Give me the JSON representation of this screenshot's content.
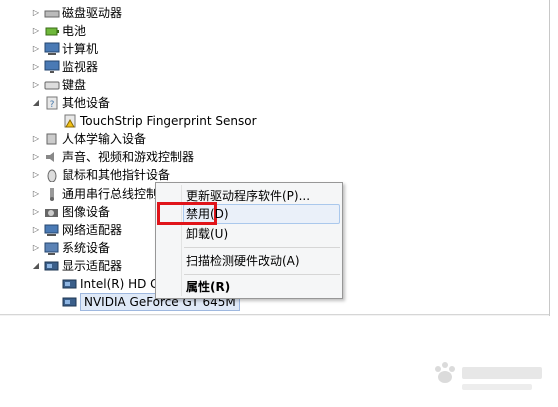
{
  "tree": {
    "items": [
      {
        "label": "磁盘驱动器",
        "indent": 0,
        "exp": "▷",
        "icon": "disk-drive-icon"
      },
      {
        "label": "电池",
        "indent": 0,
        "exp": "▷",
        "icon": "battery-icon"
      },
      {
        "label": "计算机",
        "indent": 0,
        "exp": "▷",
        "icon": "computer-icon"
      },
      {
        "label": "监视器",
        "indent": 0,
        "exp": "▷",
        "icon": "monitor-icon"
      },
      {
        "label": "键盘",
        "indent": 0,
        "exp": "▷",
        "icon": "keyboard-icon"
      },
      {
        "label": "其他设备",
        "indent": 0,
        "exp": "◢",
        "icon": "other-devices-icon"
      },
      {
        "label": "TouchStrip Fingerprint Sensor",
        "indent": 1,
        "exp": "",
        "icon": "warning-device-icon"
      },
      {
        "label": "人体学输入设备",
        "indent": 0,
        "exp": "▷",
        "icon": "hid-icon"
      },
      {
        "label": "声音、视频和游戏控制器",
        "indent": 0,
        "exp": "▷",
        "icon": "sound-icon"
      },
      {
        "label": "鼠标和其他指针设备",
        "indent": 0,
        "exp": "▷",
        "icon": "mouse-icon"
      },
      {
        "label": "通用串行总线控制器",
        "indent": 0,
        "exp": "▷",
        "icon": "usb-icon"
      },
      {
        "label": "图像设备",
        "indent": 0,
        "exp": "▷",
        "icon": "camera-icon"
      },
      {
        "label": "网络适配器",
        "indent": 0,
        "exp": "▷",
        "icon": "network-icon"
      },
      {
        "label": "系统设备",
        "indent": 0,
        "exp": "▷",
        "icon": "system-icon"
      },
      {
        "label": "显示适配器",
        "indent": 0,
        "exp": "◢",
        "icon": "display-adapter-icon"
      },
      {
        "label": "Intel(R) HD Graphics",
        "indent": 1,
        "exp": "",
        "icon": "display-adapter-icon"
      },
      {
        "label": "NVIDIA GeForce GT 645M",
        "indent": 1,
        "exp": "",
        "icon": "display-adapter-icon"
      }
    ]
  },
  "context_menu": {
    "update_driver": "更新驱动程序软件(P)...",
    "disable": "禁用(D)",
    "uninstall": "卸载(U)",
    "scan": "扫描检测硬件改动(A)",
    "properties": "属性(R)"
  },
  "colors": {
    "highlight_box": "#e0141a",
    "selection_bg": "#dfe9f7"
  }
}
